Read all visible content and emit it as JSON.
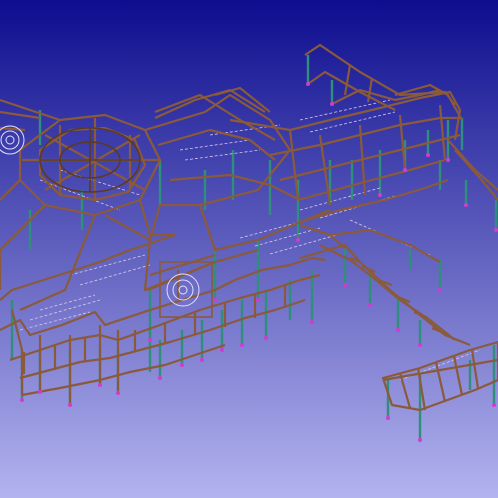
{
  "viewport": {
    "name": "3d-structural-model-viewport",
    "background": {
      "top": "#0d0d8f",
      "bottom": "#b3b3ef"
    }
  },
  "colors": {
    "beam": "#8a5a3a",
    "beam_dark": "#5b3a24",
    "column": "#2f8f7a",
    "brace": "#c9a0c9",
    "node": "#d23ad2",
    "accent": "#e0e0ff"
  }
}
